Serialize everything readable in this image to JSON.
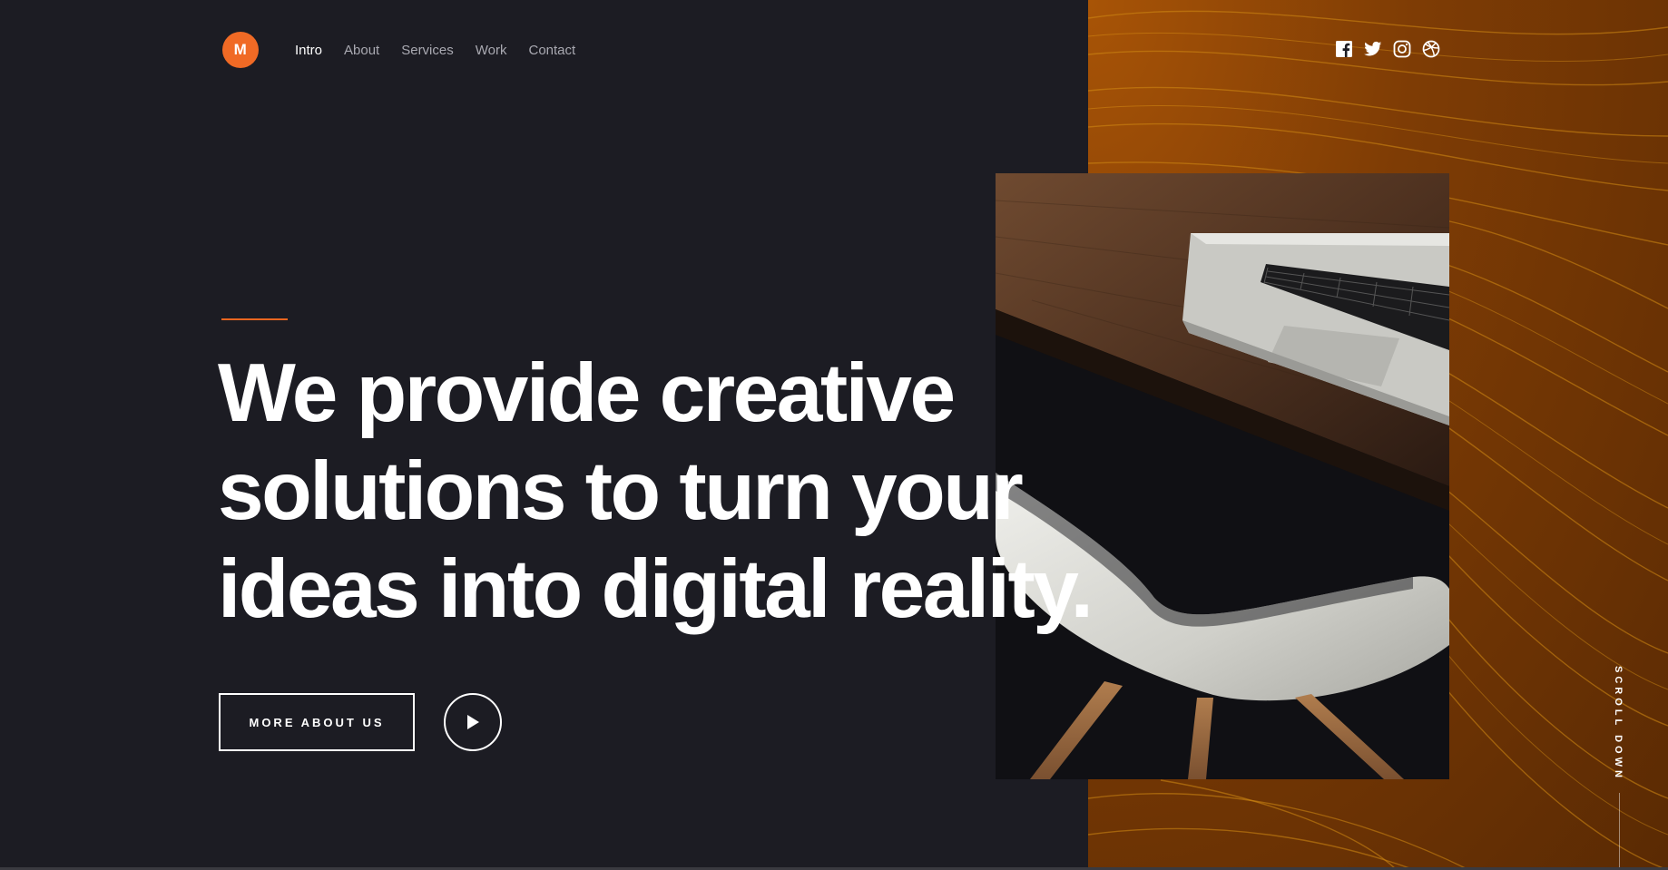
{
  "brand": {
    "logo_letter": "M",
    "accent_color": "#f06a25"
  },
  "nav": {
    "items": [
      {
        "label": "Intro",
        "active": true
      },
      {
        "label": "About",
        "active": false
      },
      {
        "label": "Services",
        "active": false
      },
      {
        "label": "Work",
        "active": false
      },
      {
        "label": "Contact",
        "active": false
      }
    ]
  },
  "social": {
    "icons": [
      "facebook-icon",
      "twitter-icon",
      "instagram-icon",
      "dribbble-icon"
    ]
  },
  "hero": {
    "headline_lines": [
      "We provide creative",
      "solutions to turn your",
      "ideas into digital reality."
    ],
    "primary_button": "MORE ABOUT US",
    "play_button_icon": "play-icon"
  },
  "scroll_hint": "SCROLL DOWN",
  "colors": {
    "background": "#1c1c23",
    "panel": "#7e3c05",
    "text": "#ffffff",
    "nav_inactive": "#a9a9b1"
  }
}
